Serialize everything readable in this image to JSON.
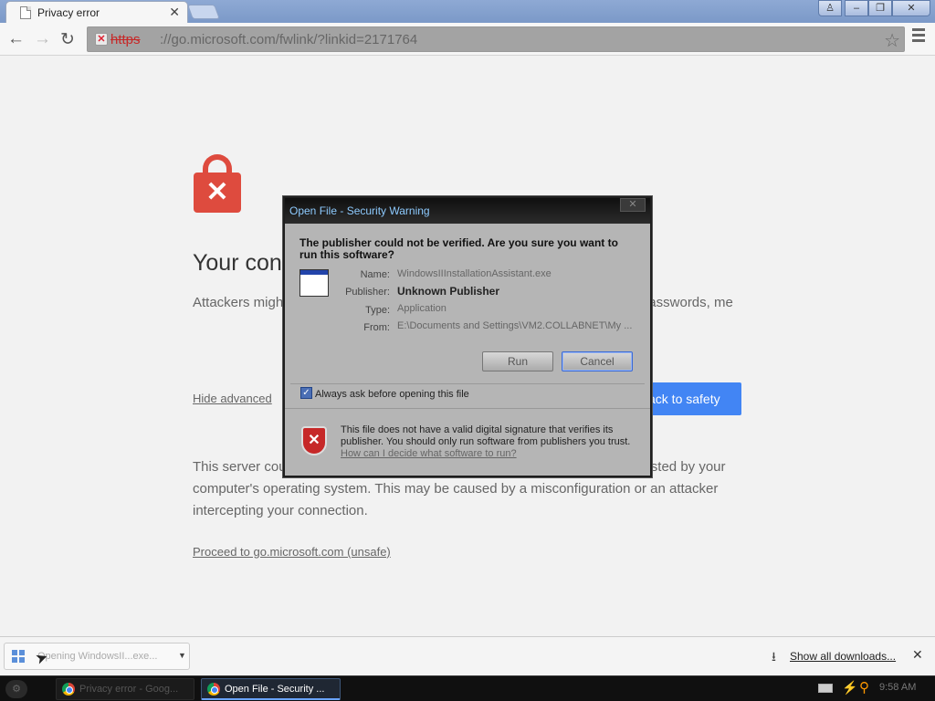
{
  "browser": {
    "tab_title": "Privacy error",
    "url_scheme": "https",
    "url_rest": "://go.microsoft.com/fwlink/?linkid=2171764"
  },
  "page": {
    "heading": "Your conr",
    "description": "Attackers might                                                                       (for example, passwords, me",
    "hide_advanced": "Hide advanced",
    "back_to_safety": "ack to safety",
    "server_text": "This server cou                                                                              te is not trusted by your computer's operating system. This may be caused by a misconfiguration or an attacker intercepting your connection.",
    "proceed_link": "Proceed to go.microsoft.com (unsafe)"
  },
  "dialog": {
    "title": "Open File - Security Warning",
    "question": "The publisher could not be verified.  Are you sure you want to run this software?",
    "labels": {
      "name": "Name:",
      "publisher": "Publisher:",
      "type": "Type:",
      "from": "From:"
    },
    "values": {
      "name": "WindowsIIInstallationAssistant.exe",
      "publisher": "Unknown Publisher",
      "type": "Application",
      "from": "E:\\Documents and Settings\\VM2.COLLABNET\\My ..."
    },
    "run_button": "Run",
    "cancel_button": "Cancel",
    "checkbox_label": "Always ask before opening this file",
    "warning_text": "This file does not have a valid digital signature that verifies its publisher.  You should only run software from publishers you trust.",
    "help_link": "How can I decide what software to run?"
  },
  "download_shelf": {
    "item_label": "Opening WindowsII...exe...",
    "show_all": "Show all downloads..."
  },
  "taskbar": {
    "task_1": "Privacy error - Goog...",
    "task_2": "Open File - Security ...",
    "clock": "9:58 AM"
  },
  "colors": {
    "titlebar": "#7b99c8",
    "accent_button": "#4285f4",
    "error_red": "#de4b3e",
    "dialog_title_text": "#8ecbff"
  }
}
